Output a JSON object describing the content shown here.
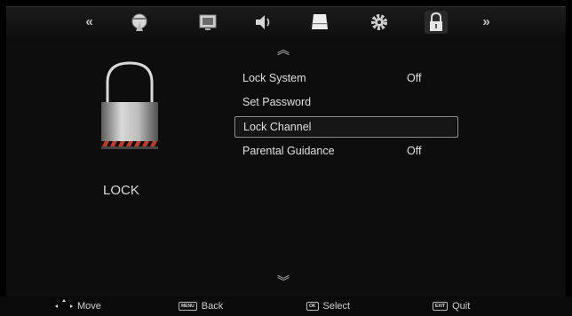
{
  "topbar": {
    "items": [
      {
        "icon": "chevron-left-icon",
        "glyph": "«"
      },
      {
        "icon": "satellite-dish-icon"
      },
      {
        "icon": "monitor-picture-icon"
      },
      {
        "icon": "speaker-sound-icon"
      },
      {
        "icon": "time-clock-icon"
      },
      {
        "icon": "gear-settings-icon"
      },
      {
        "icon": "padlock-icon",
        "active": true
      },
      {
        "icon": "chevron-right-icon",
        "glyph": "»"
      }
    ]
  },
  "page": {
    "title": "LOCK",
    "up_arrow": "︽",
    "down_arrow": "︾"
  },
  "menu": {
    "items": [
      {
        "label": "Lock System",
        "value": "Off"
      },
      {
        "label": "Set Password",
        "value": ""
      },
      {
        "label": "Lock Channel",
        "value": "",
        "selected": true
      },
      {
        "label": "Parental Guidance",
        "value": "Off"
      }
    ]
  },
  "footer": {
    "move": {
      "label": "Move"
    },
    "back": {
      "key": "MENU",
      "label": "Back"
    },
    "select": {
      "key": "OK",
      "label": "Select"
    },
    "quit": {
      "key": "EXIT",
      "label": "Quit"
    }
  },
  "colors": {
    "background": "#000000",
    "panel": "#0d0d0d",
    "text": "#e0e0e0",
    "lock_stripe": "#c0392b"
  }
}
